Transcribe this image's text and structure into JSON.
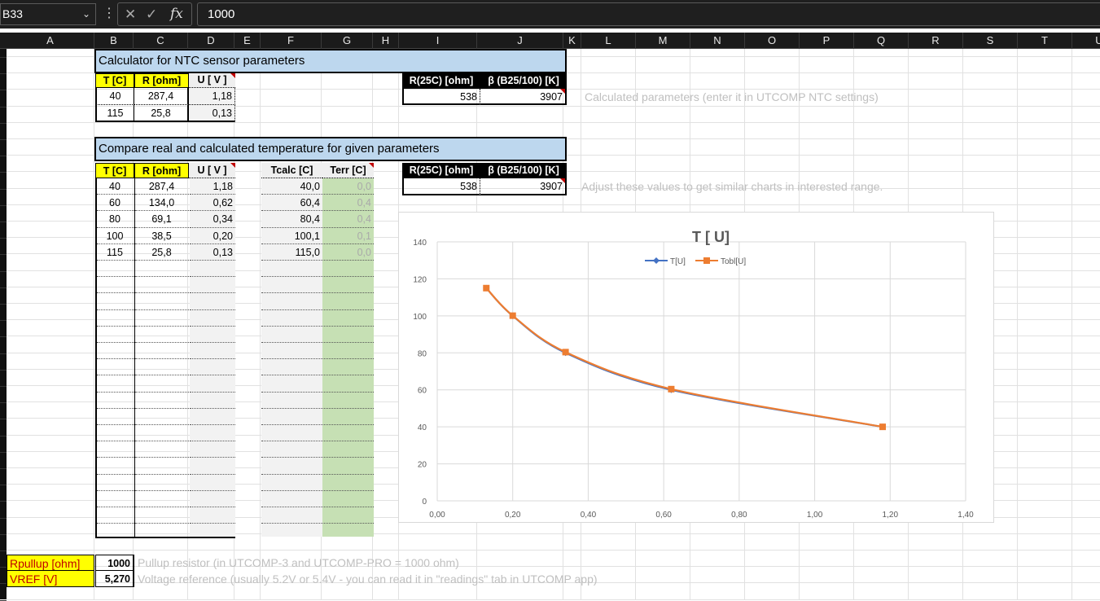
{
  "formula_bar": {
    "name_box": "B33",
    "formula": "1000"
  },
  "columns": [
    "A",
    "B",
    "C",
    "D",
    "E",
    "F",
    "G",
    "H",
    "I",
    "J",
    "K",
    "L",
    "M",
    "N",
    "O",
    "P",
    "Q",
    "R",
    "S",
    "T",
    "U"
  ],
  "calc_section": {
    "title": "Calculator for NTC sensor parameters",
    "headers": [
      "T [C]",
      "R [ohm]",
      "U [ V ]"
    ],
    "rows": [
      [
        "40",
        "287,4",
        "1,18"
      ],
      [
        "115",
        "25,8",
        "0,13"
      ]
    ],
    "params_headers": [
      "R(25C) [ohm]",
      "β (B25/100) [K]"
    ],
    "params_values": [
      "538",
      "3907"
    ],
    "note": "Calculated parameters (enter it in UTCOMP NTC settings)"
  },
  "compare_section": {
    "title": "Compare real and calculated temperature for given parameters",
    "headers": [
      "T [C]",
      "R [ohm]",
      "U [ V ]"
    ],
    "calc_headers": [
      "Tcalc [C]",
      "Terr [C]"
    ],
    "rows": [
      [
        "40",
        "287,4",
        "1,18",
        "40,0",
        "0,0"
      ],
      [
        "60",
        "134,0",
        "0,62",
        "60,4",
        "0,4"
      ],
      [
        "80",
        "69,1",
        "0,34",
        "80,4",
        "0,4"
      ],
      [
        "100",
        "38,5",
        "0,20",
        "100,1",
        "0,1"
      ],
      [
        "115",
        "25,8",
        "0,13",
        "115,0",
        "0,0"
      ]
    ],
    "params_headers": [
      "R(25C) [ohm]",
      "β (B25/100) [K]"
    ],
    "params_values": [
      "538",
      "3907"
    ],
    "note": "Adjust these values to get similar charts in interested range."
  },
  "bottom": {
    "rpullup_label": "Rpullup [ohm]",
    "rpullup_value": "1000",
    "rpullup_note": "Pullup resistor (in UTCOMP-3 and UTCOMP-PRO = 1000 ohm)",
    "vref_label": "VREF [V]",
    "vref_value": "5,270",
    "vref_note": "Voltage reference (usually 5.2V or 5.4V - you can read it in \"readings\" tab in UTCOMP app)"
  },
  "chart_data": {
    "type": "line",
    "title": "T [ U]",
    "xlim": [
      0,
      1.4
    ],
    "ylim": [
      0,
      140
    ],
    "x_ticks": [
      "0,00",
      "0,20",
      "0,40",
      "0,60",
      "0,80",
      "1,00",
      "1,20",
      "1,40"
    ],
    "y_ticks": [
      "0",
      "20",
      "40",
      "60",
      "80",
      "100",
      "120",
      "140"
    ],
    "legend_placement": "top-center",
    "grid": true,
    "series": [
      {
        "name": "T[U]",
        "color": "#4472c4",
        "x": [
          1.18,
          0.62,
          0.34,
          0.2,
          0.13
        ],
        "y": [
          40,
          60,
          80,
          100,
          115
        ]
      },
      {
        "name": "Tobl[U]",
        "color": "#ed7d31",
        "x": [
          1.18,
          0.62,
          0.34,
          0.2,
          0.13
        ],
        "y": [
          40,
          60.4,
          80.4,
          100.1,
          115
        ]
      }
    ]
  }
}
